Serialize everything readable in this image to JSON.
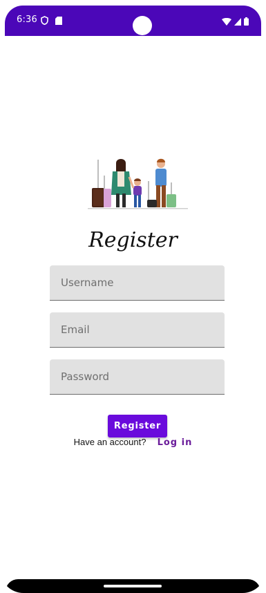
{
  "status_bar": {
    "time": "6:36",
    "icons_left": [
      "vpn-shield-icon",
      "sim-card-icon"
    ],
    "icons_right": [
      "wifi-icon",
      "signal-icon",
      "battery-icon"
    ],
    "color": "#4b07b8"
  },
  "screen": {
    "title": "Register",
    "illustration": "family-travel-illustration"
  },
  "form": {
    "username": {
      "placeholder": "Username",
      "value": ""
    },
    "email": {
      "placeholder": "Email",
      "value": ""
    },
    "password": {
      "placeholder": "Password",
      "value": ""
    },
    "submit_label": "Register"
  },
  "footer": {
    "prompt": "Have an account?",
    "link_label": "Log in"
  },
  "colors": {
    "accent": "#6a0bdc",
    "link": "#6a1b9a"
  }
}
